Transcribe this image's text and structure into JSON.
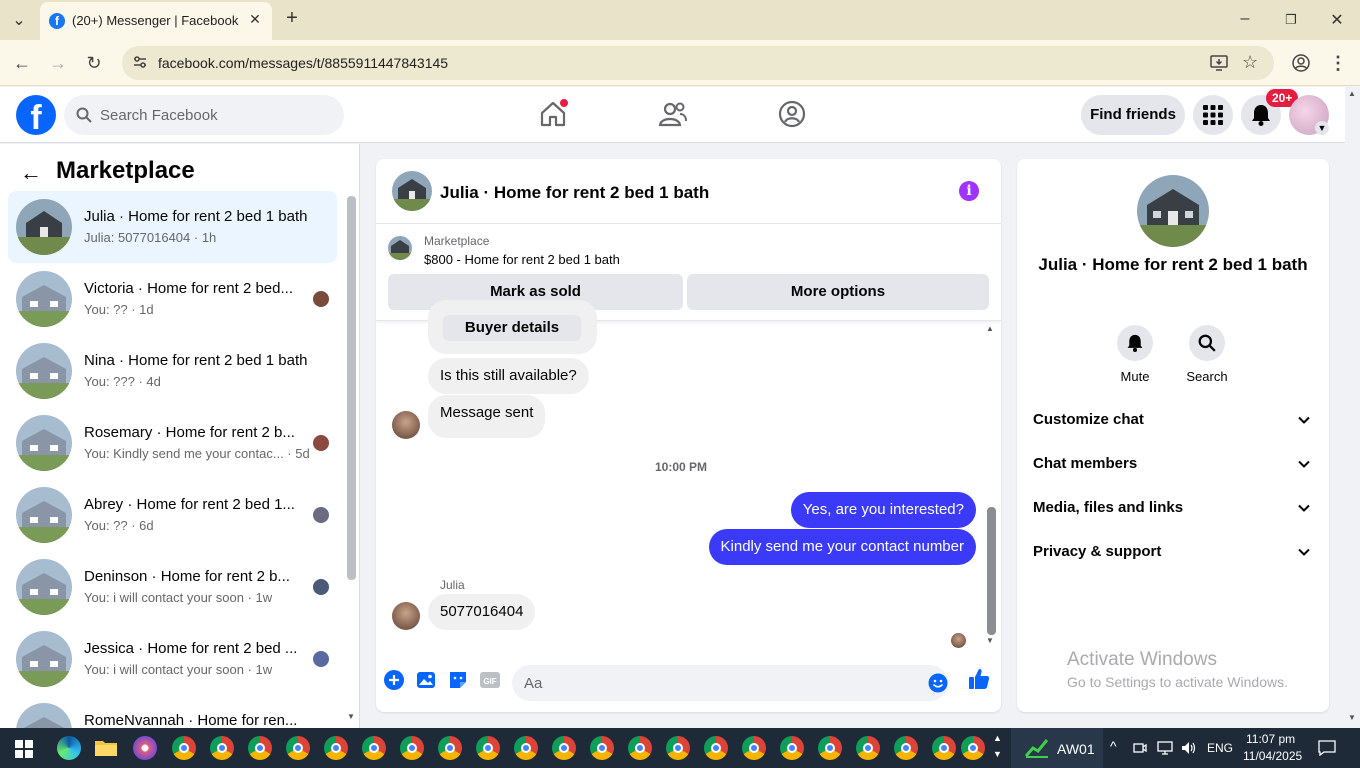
{
  "browser": {
    "tab_title": "(20+) Messenger | Facebook",
    "url": "facebook.com/messages/t/8855911447843145"
  },
  "fb_nav": {
    "search_placeholder": "Search Facebook",
    "find_friends": "Find friends",
    "notif_count": "20+"
  },
  "left_panel": {
    "title": "Marketplace",
    "conversations": [
      {
        "name": "Julia · Home for rent 2 bed 1 bath",
        "sub": "Julia: 5077016404 · 1h"
      },
      {
        "name": "Victoria · Home for rent 2 bed...",
        "sub": "You: ?? · 1d"
      },
      {
        "name": "Nina · Home for rent 2 bed 1 bath",
        "sub": "You: ??? · 4d"
      },
      {
        "name": "Rosemary · Home for rent 2 b...",
        "sub": "You: Kindly send me your contac... · 5d"
      },
      {
        "name": "Abrey · Home for rent 2 bed 1...",
        "sub": "You: ?? · 6d"
      },
      {
        "name": "Deninson · Home for rent 2 b...",
        "sub": "You: i will contact your soon · 1w"
      },
      {
        "name": "Jessica · Home for rent 2 bed ...",
        "sub": "You: i will contact your soon · 1w"
      },
      {
        "name": "RomeNvannah · Home for ren...",
        "sub": ""
      }
    ]
  },
  "chat": {
    "title": "Julia · Home for rent 2 bed 1 bath",
    "marketplace_label": "Marketplace",
    "listing": "$800 - Home for rent 2 bed 1 bath",
    "mark_sold": "Mark as sold",
    "more_options": "More options",
    "messages": {
      "buyer_details": "Buyer details",
      "m1": "Is this still available?",
      "m2": "Message sent",
      "timestamp": "10:00 PM",
      "m3": "Yes, are you interested?",
      "m4": "Kindly send me your contact number",
      "sender": "Julia",
      "m5": "5077016404"
    },
    "input_placeholder": "Aa"
  },
  "right_panel": {
    "name": "Julia · Home for rent 2 bed 1 bath",
    "mute": "Mute",
    "search": "Search",
    "sections": [
      "Customize chat",
      "Chat members",
      "Media, files and links",
      "Privacy & support"
    ],
    "watermark_title": "Activate Windows",
    "watermark_sub": "Go to Settings to activate Windows."
  },
  "taskbar": {
    "network_label": "AW01",
    "lang": "ENG",
    "time": "11:07 pm",
    "date": "11/04/2025"
  },
  "colors": {
    "fb_blue": "#0866ff",
    "outgoing_bubble": "#3a3af8",
    "info_purple": "#a033ff",
    "badge_red": "#e41e3f"
  }
}
